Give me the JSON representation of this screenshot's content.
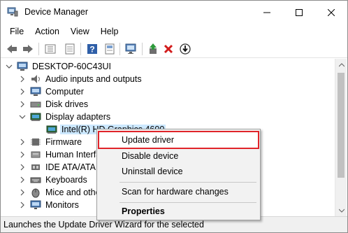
{
  "window": {
    "title": "Device Manager",
    "accent": "#e0242a"
  },
  "menu": [
    "File",
    "Action",
    "View",
    "Help"
  ],
  "toolbar": {
    "icons": [
      "back-icon",
      "forward-icon",
      "view-icon",
      "properties-icon",
      "help-icon",
      "scan-icon",
      "enable-device-icon",
      "uninstall-icon",
      "update-driver-icon"
    ]
  },
  "tree": {
    "root": "DESKTOP-60C43UI",
    "items": [
      {
        "label": "Audio inputs and outputs",
        "icon": "speaker-icon",
        "expanded": false
      },
      {
        "label": "Computer",
        "icon": "computer-icon",
        "expanded": false
      },
      {
        "label": "Disk drives",
        "icon": "disk-drive-icon",
        "expanded": false
      },
      {
        "label": "Display adapters",
        "icon": "display-adapter-icon",
        "expanded": true
      },
      {
        "label": "Intel(R) HD Graphics 4600",
        "icon": "display-adapter-icon",
        "child": true,
        "selected": true
      },
      {
        "label": "Firmware",
        "icon": "firmware-icon",
        "expanded": false
      },
      {
        "label": "Human Interface Devices",
        "icon": "hid-icon",
        "expanded": false
      },
      {
        "label": "IDE ATA/ATAPI controllers",
        "icon": "ide-controller-icon",
        "expanded": false
      },
      {
        "label": "Keyboards",
        "icon": "keyboard-icon",
        "expanded": false
      },
      {
        "label": "Mice and other pointing devices",
        "icon": "mouse-icon",
        "expanded": false
      },
      {
        "label": "Monitors",
        "icon": "monitor-icon",
        "expanded": false
      }
    ]
  },
  "context_menu": {
    "items": [
      "Update driver",
      "Disable device",
      "Uninstall device",
      "Scan for hardware changes",
      "Properties"
    ],
    "highlighted": "Update driver"
  },
  "status": {
    "text": "Launches the Update Driver Wizard for the selected"
  }
}
